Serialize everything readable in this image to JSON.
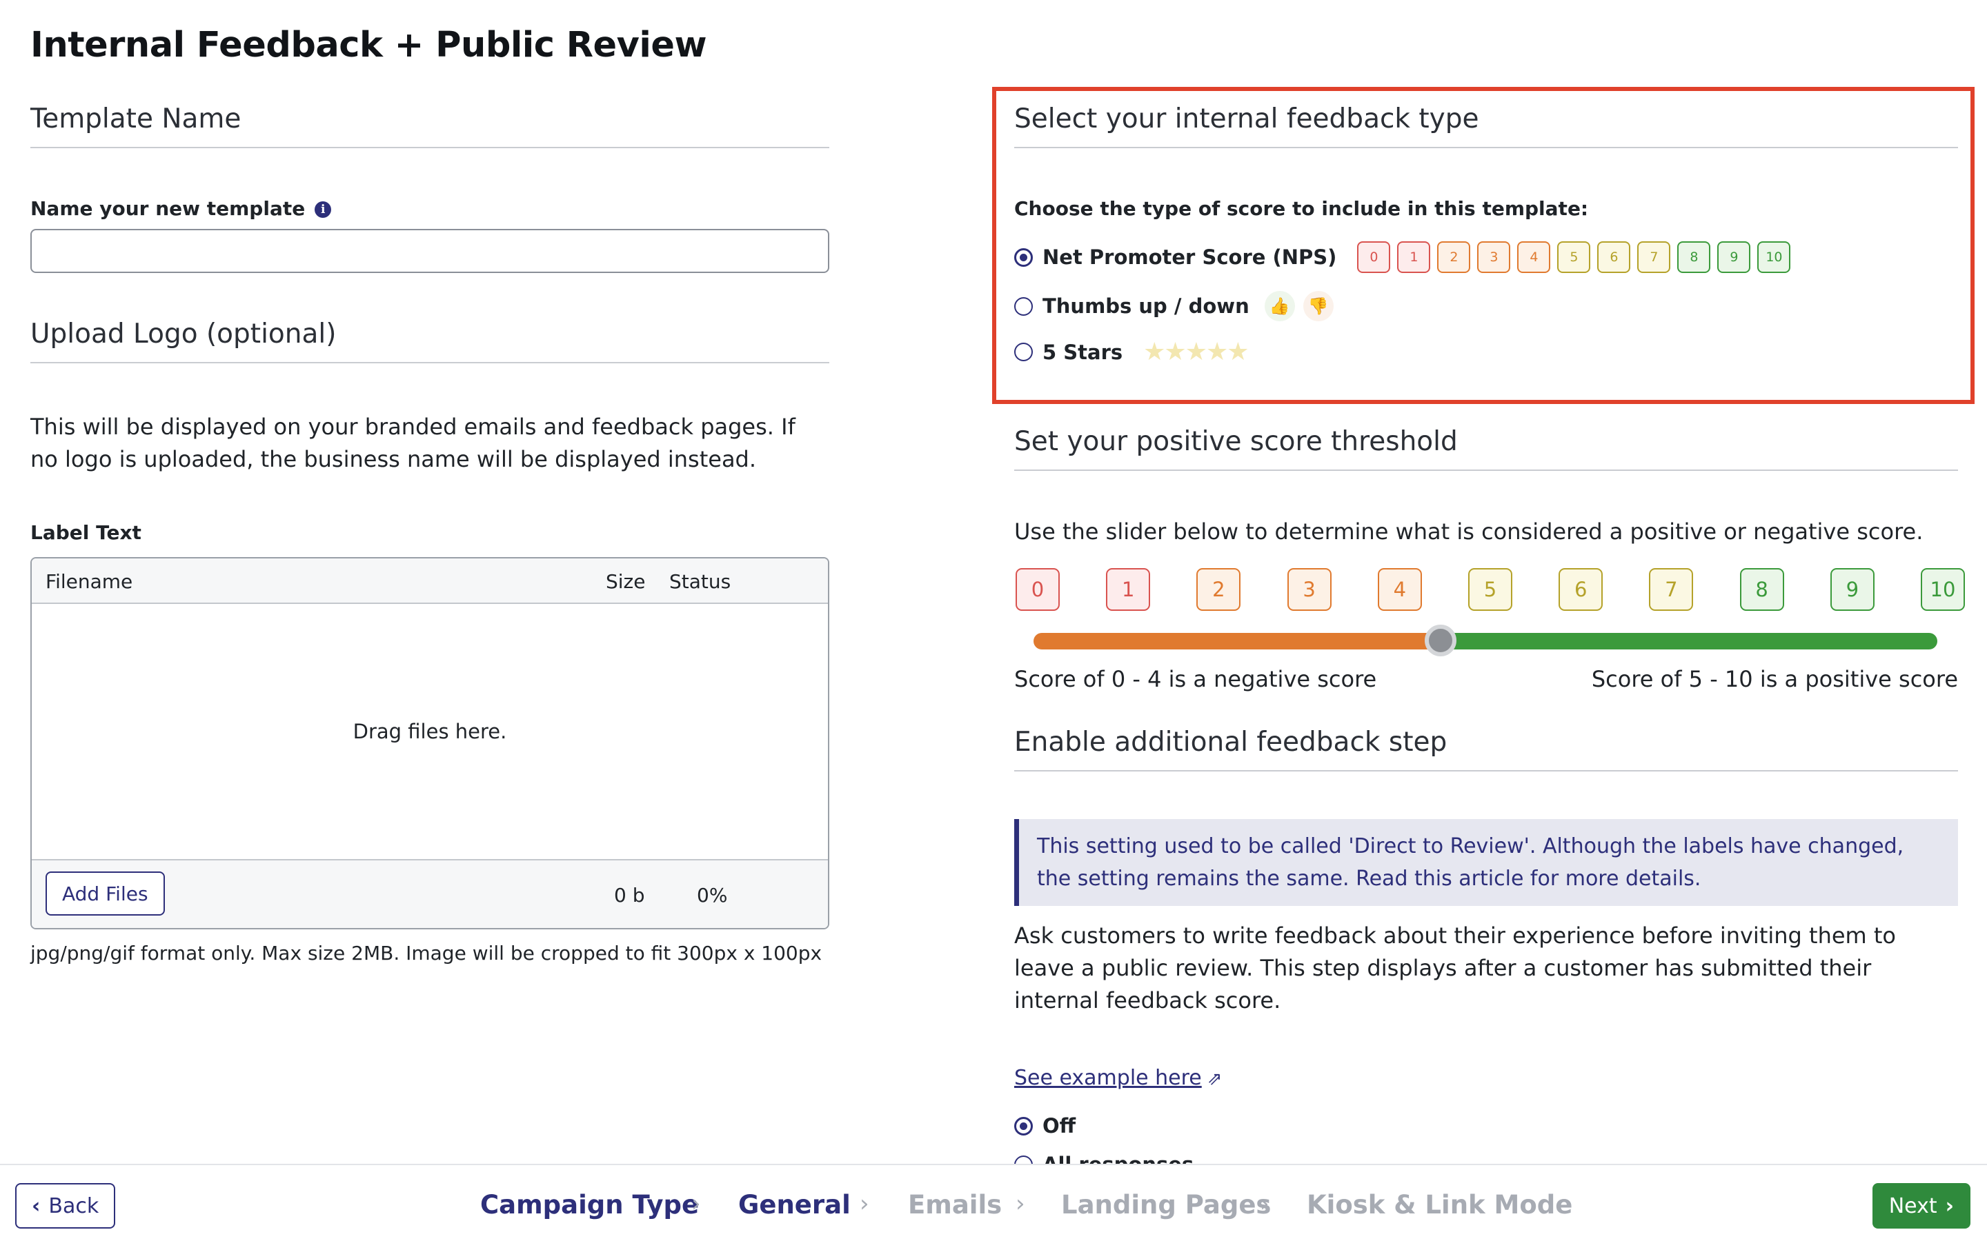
{
  "page": {
    "title": "Internal Feedback + Public Review"
  },
  "left": {
    "template_section_title": "Template Name",
    "name_label": "Name your new template",
    "name_info_icon": "i",
    "name_value": "",
    "logo_section_title": "Upload Logo (optional)",
    "logo_description": "This will be displayed on your branded emails and feedback pages. If no logo is uploaded, the business name will be displayed instead.",
    "label_text": "Label Text",
    "uploader": {
      "col_filename": "Filename",
      "col_size": "Size",
      "col_status": "Status",
      "drop_text": "Drag files here.",
      "add_files_label": "Add Files",
      "total_size": "0 b",
      "total_percent": "0%"
    },
    "format_hint": "jpg/png/gif format only. Max size 2MB. Image will be cropped to fit 300px x 100px"
  },
  "feedback_type": {
    "section_title": "Select your internal feedback type",
    "prompt": "Choose the type of score to include in this template:",
    "options": [
      {
        "label": "Net Promoter Score (NPS)",
        "selected": true
      },
      {
        "label": "Thumbs up / down",
        "selected": false
      },
      {
        "label": "5 Stars",
        "selected": false
      }
    ],
    "nps_scores": [
      "0",
      "1",
      "2",
      "3",
      "4",
      "5",
      "6",
      "7",
      "8",
      "9",
      "10"
    ],
    "thumb_up_icon": "thumbs-up-icon",
    "thumb_down_icon": "thumbs-down-icon",
    "stars_icon": "star-icon",
    "stars": "★★★★★"
  },
  "threshold": {
    "section_title": "Set your positive score threshold",
    "description": "Use the slider below to determine what is considered a positive or negative score.",
    "scores": [
      "0",
      "1",
      "2",
      "3",
      "4",
      "5",
      "6",
      "7",
      "8",
      "9",
      "10"
    ],
    "slider_value": 4.5,
    "slider_min": 0,
    "slider_max": 10,
    "negative_note": "Score of 0 - 4 is a negative score",
    "positive_note": "Score of 5 - 10 is a positive score",
    "colors": {
      "negative": "#e07a2f",
      "positive": "#3b9a3b"
    }
  },
  "additional_step": {
    "section_title": "Enable additional feedback step",
    "notice": "This setting used to be called 'Direct to Review'. Although the labels have changed, the setting remains the same. Read this article for more details.",
    "description": "Ask customers to write feedback about their experience before inviting them to leave a public review. This step displays after a customer has submitted their internal feedback score.",
    "example_link": "See example here",
    "example_link_icon": "external-link-icon",
    "options": [
      {
        "label": "Off",
        "selected": true
      },
      {
        "label": "All responses",
        "selected": false
      }
    ]
  },
  "footer": {
    "back_label": "Back",
    "next_label": "Next",
    "steps": [
      {
        "label": "Campaign Type",
        "state": "done"
      },
      {
        "label": "General",
        "state": "current"
      },
      {
        "label": "Emails",
        "state": "todo"
      },
      {
        "label": "Landing Pages",
        "state": "todo"
      },
      {
        "label": "Kiosk & Link Mode",
        "state": "todo"
      }
    ],
    "separator": "›"
  },
  "colors": {
    "brand": "#2d2f7a",
    "highlight": "#e0412b",
    "next_button": "#2f8a3c"
  }
}
